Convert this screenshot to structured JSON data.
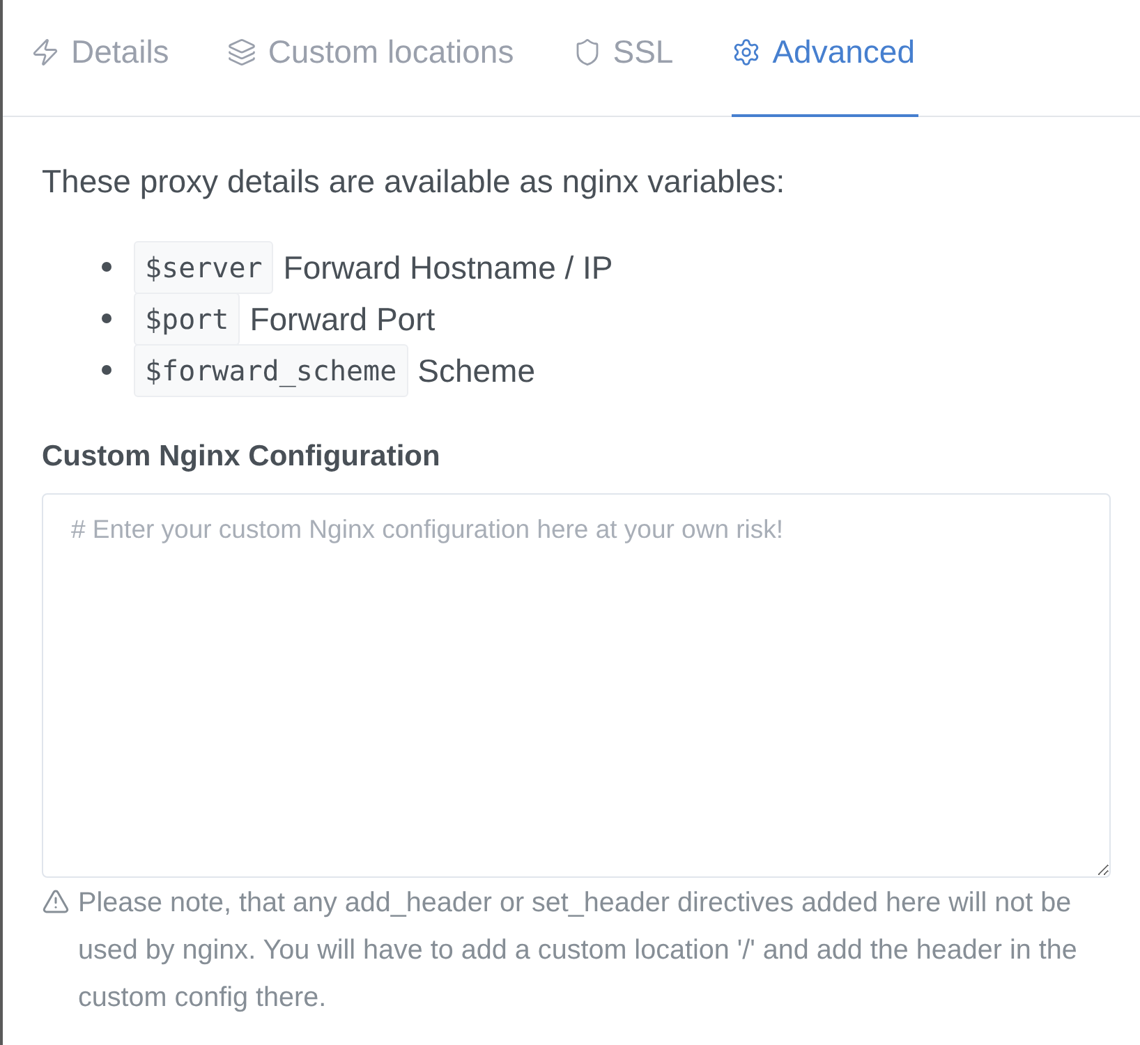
{
  "tabs": [
    {
      "label": "Details",
      "selected": false
    },
    {
      "label": "Custom locations",
      "selected": false
    },
    {
      "label": "SSL",
      "selected": false
    },
    {
      "label": "Advanced",
      "selected": true
    }
  ],
  "intro": "These proxy details are available as nginx variables:",
  "variables": [
    {
      "code": "$server",
      "description": "Forward Hostname / IP"
    },
    {
      "code": "$port",
      "description": "Forward Port"
    },
    {
      "code": "$forward_scheme",
      "description": "Scheme"
    }
  ],
  "config": {
    "label": "Custom Nginx Configuration",
    "placeholder": "# Enter your custom Nginx configuration here at your own risk!"
  },
  "note": "Please note, that any add_header or set_header directives added here will not be used by nginx. You will have to add a custom location '/' and add the header in the custom config there."
}
